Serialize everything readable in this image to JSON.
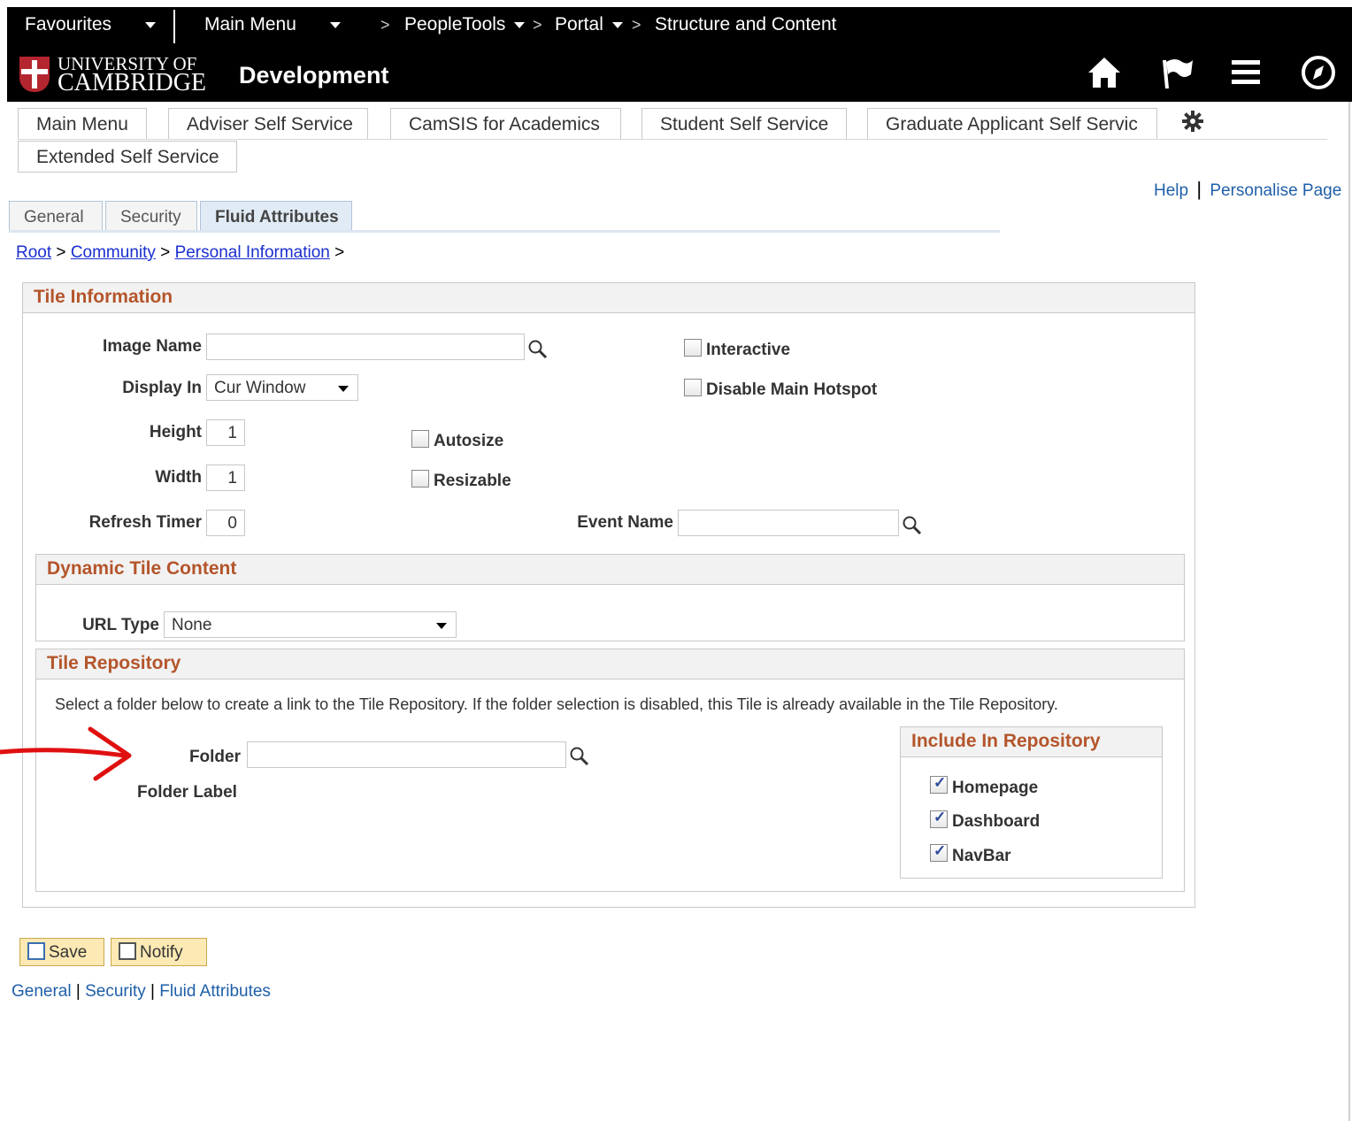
{
  "header": {
    "favourites": "Favourites",
    "main_menu": "Main Menu",
    "breadcrumbs": [
      "PeopleTools",
      "Portal",
      "Structure and Content"
    ],
    "logo_line1": "UNIVERSITY OF",
    "logo_line2": "CAMBRIDGE",
    "environment": "Development",
    "icons": [
      "home-icon",
      "flag-icon",
      "menu-icon",
      "compass-icon"
    ]
  },
  "homepage_tabs": [
    "Main Menu",
    "Adviser Self Service",
    "CamSIS for Academics",
    "Student Self Service",
    "Graduate Applicant Self Servic",
    "Extended Self Service"
  ],
  "help_links": {
    "help": "Help",
    "sep": "|",
    "personalise": "Personalise Page"
  },
  "page_tabs": {
    "general": "General",
    "security": "Security",
    "fluid": "Fluid Attributes"
  },
  "path": {
    "root": "Root",
    "community": "Community",
    "personal": "Personal Information",
    "sep": ">"
  },
  "tile_info": {
    "title": "Tile Information",
    "image_name_label": "Image Name",
    "image_name_value": "",
    "display_in_label": "Display In",
    "display_in_value": "Cur Window",
    "height_label": "Height",
    "height_value": "1",
    "width_label": "Width",
    "width_value": "1",
    "refresh_label": "Refresh Timer",
    "refresh_value": "0",
    "autosize": "Autosize",
    "resizable": "Resizable",
    "interactive": "Interactive",
    "disable_hotspot": "Disable Main Hotspot",
    "event_name_label": "Event Name",
    "event_name_value": ""
  },
  "dynamic": {
    "title": "Dynamic Tile Content",
    "url_type_label": "URL Type",
    "url_type_value": "None"
  },
  "repository": {
    "title": "Tile Repository",
    "info": "Select a folder below to create a link to the Tile Repository. If the folder selection is disabled, this Tile is already available in the Tile Repository.",
    "folder_label": "Folder",
    "folder_value": "",
    "folder_label_label": "Folder Label",
    "include_title": "Include In Repository",
    "include_items": [
      {
        "label": "Homepage",
        "checked": true
      },
      {
        "label": "Dashboard",
        "checked": true
      },
      {
        "label": "NavBar",
        "checked": true
      }
    ]
  },
  "buttons": {
    "save": "Save",
    "notify": "Notify"
  },
  "footer_links": {
    "general": "General",
    "security": "Security",
    "fluid": "Fluid Attributes",
    "sep": "|"
  },
  "colors": {
    "header_bg": "#000000",
    "section_title": "#b4552b",
    "link": "#1f5fa8",
    "annotation_arrow": "#e01010"
  }
}
